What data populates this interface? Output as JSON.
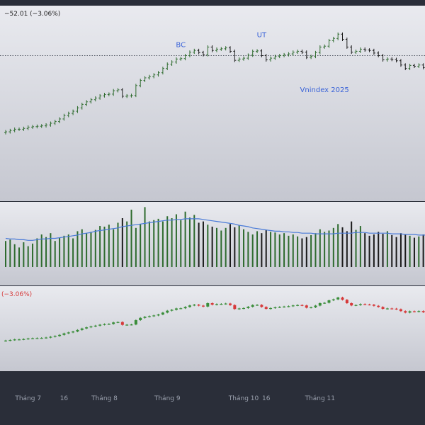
{
  "colors": {
    "frame": "#2a2e39",
    "pane_top": "#e9eaef",
    "pane_bottom": "#c5c7d0",
    "bar_up": "#2e6b2e",
    "bar_down": "#1b1b1b",
    "candle_up": "#3a8d3a",
    "candle_down": "#d63a3a",
    "volume_ma": "#4a7bd8",
    "annotation": "#3a63d8",
    "axis_text": "#9aa0ad",
    "ref_line": "#555a66"
  },
  "chart_data": [
    {
      "type": "ohlc",
      "pane": "price",
      "legend_change": "−52.01 (−3.06%)",
      "annotations": [
        {
          "text": "BC",
          "x": 39,
          "y": 1610
        },
        {
          "text": "UT",
          "x": 57,
          "y": 1633
        },
        {
          "text": "Vnindex 2025",
          "x": 71,
          "y": 1505
        }
      ],
      "reference_price": 1590,
      "ylim": [
        1250,
        1700
      ],
      "close": [
        1412,
        1415,
        1418,
        1418,
        1420,
        1423,
        1424,
        1425,
        1426,
        1428,
        1432,
        1436,
        1442,
        1450,
        1455,
        1460,
        1468,
        1476,
        1482,
        1487,
        1491,
        1496,
        1499,
        1500,
        1508,
        1510,
        1495,
        1496,
        1497,
        1520,
        1532,
        1538,
        1541,
        1545,
        1550,
        1560,
        1570,
        1575,
        1582,
        1583,
        1590,
        1598,
        1602,
        1597,
        1592,
        1610,
        1602,
        1605,
        1606,
        1608,
        1600,
        1579,
        1582,
        1584,
        1591,
        1600,
        1601,
        1590,
        1580,
        1584,
        1588,
        1590,
        1592,
        1594,
        1598,
        1600,
        1598,
        1586,
        1588,
        1597,
        1610,
        1612,
        1625,
        1630,
        1640,
        1628,
        1610,
        1598,
        1600,
        1605,
        1603,
        1602,
        1596,
        1590,
        1580,
        1582,
        1581,
        1578,
        1568,
        1560,
        1567,
        1565,
        1568,
        1562,
        1560
      ]
    },
    {
      "type": "bar",
      "pane": "volume",
      "ylim": [
        0,
        100
      ],
      "values": [
        40,
        42,
        35,
        30,
        38,
        32,
        36,
        44,
        50,
        46,
        52,
        40,
        45,
        48,
        50,
        44,
        55,
        58,
        52,
        54,
        57,
        63,
        62,
        65,
        58,
        68,
        75,
        70,
        88,
        60,
        66,
        92,
        70,
        72,
        74,
        70,
        78,
        75,
        81,
        72,
        85,
        76,
        80,
        68,
        70,
        65,
        62,
        60,
        56,
        60,
        66,
        61,
        64,
        58,
        54,
        50,
        55,
        52,
        57,
        54,
        53,
        50,
        52,
        48,
        50,
        47,
        44,
        46,
        49,
        52,
        58,
        54,
        56,
        60,
        66,
        61,
        55,
        70,
        57,
        63,
        52,
        48,
        50,
        54,
        51,
        55,
        49,
        46,
        52,
        50,
        48,
        45,
        47,
        50,
        46
      ],
      "ma": [
        44,
        43,
        43,
        42,
        42,
        41,
        41,
        42,
        43,
        43,
        44,
        44,
        45,
        46,
        47,
        48,
        49,
        51,
        52,
        53,
        55,
        56,
        57,
        58,
        59,
        60,
        62,
        63,
        64,
        65,
        66,
        67,
        68,
        69,
        70,
        71,
        72,
        72,
        73,
        73,
        74,
        74,
        74,
        74,
        73,
        72,
        71,
        70,
        69,
        68,
        67,
        66,
        64,
        63,
        62,
        60,
        59,
        58,
        57,
        56,
        55,
        55,
        54,
        54,
        53,
        53,
        52,
        52,
        52,
        51,
        51,
        51,
        51,
        51,
        52,
        52,
        52,
        52,
        53,
        53,
        53,
        52,
        52,
        52,
        52,
        52,
        51,
        51,
        51,
        50,
        50,
        50,
        49,
        49,
        49
      ]
    },
    {
      "type": "candlestick",
      "pane": "candles",
      "legend_change": "(−3.06%)",
      "ylim": [
        1250,
        1700
      ]
    }
  ],
  "x_axis": {
    "ticks": [
      {
        "label": "Tháng 7",
        "index": 5
      },
      {
        "label": "16",
        "index": 13
      },
      {
        "label": "Tháng 8",
        "index": 22
      },
      {
        "label": "Tháng 9",
        "index": 36
      },
      {
        "label": "Tháng 10",
        "index": 53
      },
      {
        "label": "16",
        "index": 58
      },
      {
        "label": "Tháng 11",
        "index": 70
      }
    ]
  }
}
